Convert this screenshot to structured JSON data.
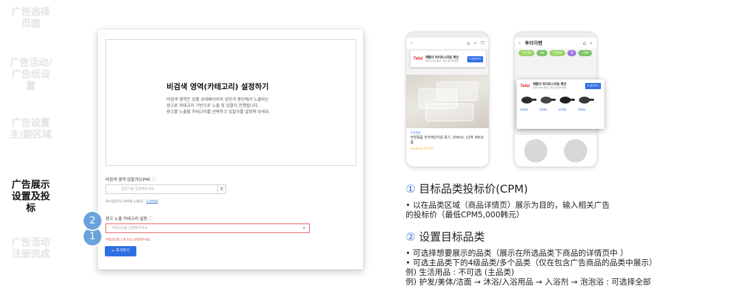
{
  "steps": [
    {
      "label_lines": [
        "广告选择",
        "页面"
      ],
      "active": false
    },
    {
      "label_lines": [
        "广告活动/",
        "广告组设",
        "置"
      ],
      "active": false
    },
    {
      "label_lines": [
        "广告设置",
        "主/副区域"
      ],
      "active": false
    },
    {
      "label_lines": [
        "广告展示",
        "设置及投",
        "标"
      ],
      "active": true
    },
    {
      "label_lines": [
        "广告活动",
        "注册完成"
      ],
      "active": false
    }
  ],
  "panel": {
    "empty_title": "비검색 영역(카테고리) 설정하기",
    "empty_desc": [
      "비검색 영역은 상품 상세페이지의 상단과 중단에서 노출되는",
      "광고로 카테고리 기반으로 노출 및 입찰이 진행됩니다.",
      "광고를 노출할 카테고리를 선택하고 입찰가를 설정해 보세요."
    ],
    "badge1": "1",
    "badge2": "2",
    "bid_label": "비검색 영역 입찰가(CPM)",
    "bid_placeholder": "입찰가를 입력해주세요",
    "bid_unit": "원",
    "min_bid_prefix": "최소입찰가(1,000회 노출당) : ",
    "min_bid_value": "5,000원",
    "cat_label": "광고 노출 카테고리 설정",
    "cat_placeholder": "카테고리를 선택해주세요",
    "cat_error": "카테고리를 1개 이상 선택해주세요.",
    "add_button": "+ 추가하기"
  },
  "phone1": {
    "brand": "Tefal",
    "ad_title": "테팔의 라이프스타일 제안",
    "ad_sub": "최대 40% 할인, 지금 만나보세요",
    "ad_button": "더 알아보기",
    "product_category": "주방용품",
    "product_name": "주방용품 전자레인지용 용기, 200ml, 12개 세트상품",
    "product_rating": "★★★★★ (4,755)"
  },
  "phone2": {
    "title": "후리이팬",
    "chips": [
      "프라이팬",
      "냄비",
      "주방세트",
      "웍",
      "그릴팬"
    ],
    "brand": "Tefal",
    "ad_title": "테팔의 라이프스타일 제안",
    "ad_sub": "최대 40% 할인, 지금 만나보세요",
    "ad_button": "더 알아보기",
    "pan_labels": [
      "로켓배송",
      "로켓배송",
      "로켓배송",
      "로켓배송"
    ]
  },
  "section1": {
    "number": "①",
    "title": "目标品类投标价(CPM)",
    "lines": [
      "• 以在品类区域（商品详情页）展示为目的，输入相关广告",
      "的投标价（最低CPM5,000韩元）"
    ]
  },
  "section2": {
    "number": "②",
    "title": "设置目标品类",
    "lines": [
      "• 可选择想要展示的品类（展示在所选品类下商品的详情页中 ）",
      "• 可选主品类下的4级品类/多个品类（仅在包含广告商品的品类中展示）",
      "  例) 生活用品 : 不可选 (主品类)",
      "  例) 护发/美体/洁面 → 沐浴/入浴用品 → 入浴剂 → 泡泡浴 : 可选择全部"
    ]
  },
  "colors": {
    "accent_blue": "#3d7fd1",
    "badge_blue": "#6aa2dc",
    "button_blue": "#2f6fe4",
    "error_red": "#e04848",
    "rail_inactive": "#e3e3e3"
  }
}
